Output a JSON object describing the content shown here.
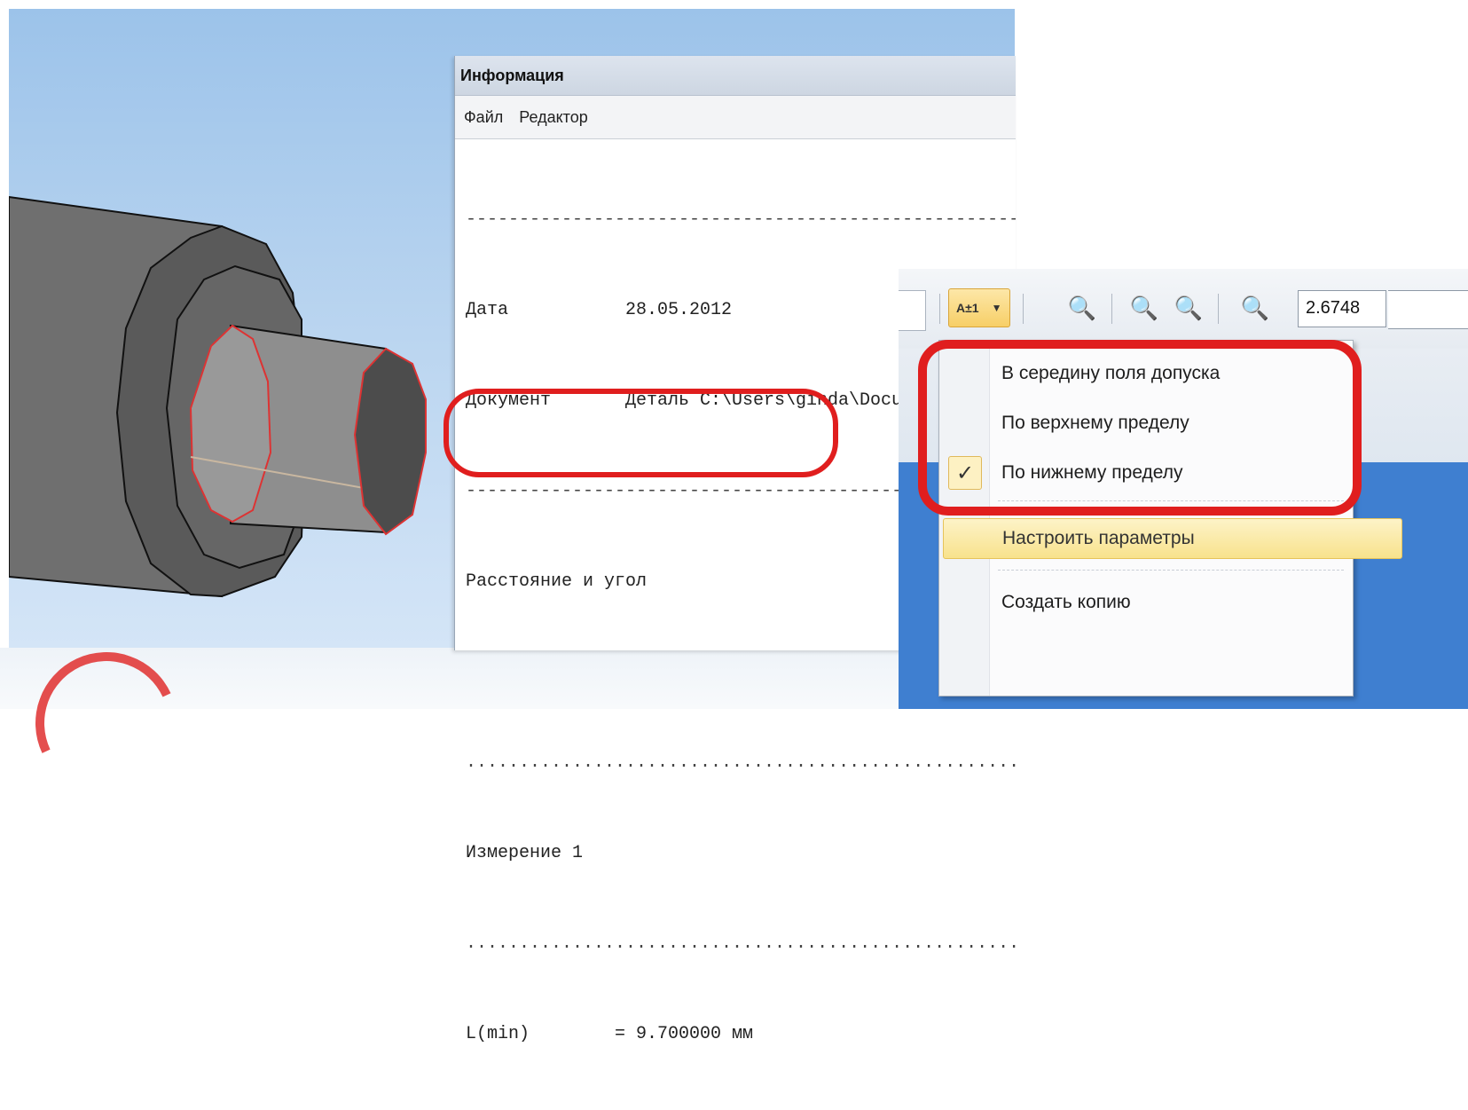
{
  "info_window": {
    "title": "Информация",
    "menu": [
      "Файл",
      "Редактор"
    ],
    "separator": "--------------------------------------------------------------",
    "dotted": "..............................................................",
    "date_label": "Дата",
    "date_value": "28.05.2012",
    "doc_label": "Документ",
    "doc_value": "Деталь C:\\Users\\ginda\\Docu",
    "section": "Расстояние и угол",
    "measure_label": "Измерение 1",
    "result_label": "L(min)",
    "result_value": "= 9.700000 мм"
  },
  "toolbar": {
    "dimension_icon_text": "A±1",
    "zoom_value": "2.6748"
  },
  "context_menu": {
    "items": [
      {
        "label": "В середину поля допуска",
        "checked": false
      },
      {
        "label": "По верхнему пределу",
        "checked": false
      },
      {
        "label": "По нижнему пределу",
        "checked": true
      }
    ],
    "check_mark": "✓",
    "hover_item": "Настроить параметры",
    "last_item": "Создать копию"
  },
  "colors": {
    "highlight": "#e01e1e",
    "viewport_sky": "#9cc3ea",
    "part_gray": "#7a7a7a",
    "menu_hover": "#f8e28c"
  }
}
